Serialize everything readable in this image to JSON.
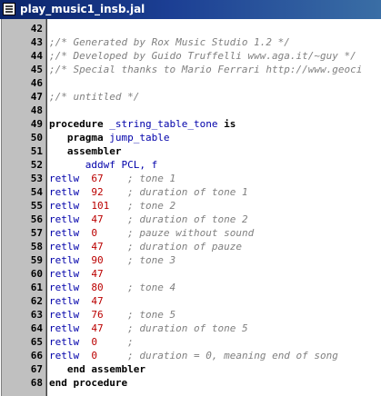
{
  "window": {
    "title": "play_music1_insb.jal"
  },
  "colors": {
    "titlebar": "#0a246a",
    "comment": "#808080",
    "keyword": "#000000",
    "instruction": "#0000aa",
    "number": "#bb0000",
    "gutter": "#c0c0c0"
  },
  "icons": [
    "document-icon"
  ],
  "lines": [
    {
      "n": "42",
      "text": ""
    },
    {
      "n": "43",
      "text": ";/* Generated by Rox Music Studio 1.2 */"
    },
    {
      "n": "44",
      "text": ";/* Developed by Guido Truffelli www.aga.it/~guy */"
    },
    {
      "n": "45",
      "text": ";/* Special thanks to Mario Ferrari http://www.geoci"
    },
    {
      "n": "46",
      "text": ""
    },
    {
      "n": "47",
      "text": ";/* untitled */"
    },
    {
      "n": "48",
      "text": ""
    },
    {
      "n": "49",
      "kw": "procedure",
      "ident": "_string_table_tone",
      "kw2": "is"
    },
    {
      "n": "50",
      "indent": "   ",
      "kw": "pragma",
      "ident": "jump_table"
    },
    {
      "n": "51",
      "indent": "   ",
      "kw": "assembler"
    },
    {
      "n": "52",
      "indent": "      ",
      "ident": "addwf PCL, f"
    },
    {
      "n": "53",
      "op": "retlw",
      "val": "67",
      "cmt": "; tone 1"
    },
    {
      "n": "54",
      "op": "retlw",
      "val": "92",
      "cmt": "; duration of tone 1"
    },
    {
      "n": "55",
      "op": "retlw",
      "val": "101",
      "cmt": "; tone 2"
    },
    {
      "n": "56",
      "op": "retlw",
      "val": "47",
      "cmt": "; duration of tone 2"
    },
    {
      "n": "57",
      "op": "retlw",
      "val": "0",
      "cmt": "; pauze without sound"
    },
    {
      "n": "58",
      "op": "retlw",
      "val": "47",
      "cmt": "; duration of pauze"
    },
    {
      "n": "59",
      "op": "retlw",
      "val": "90",
      "cmt": "; tone 3"
    },
    {
      "n": "60",
      "op": "retlw",
      "val": "47",
      "cmt": ""
    },
    {
      "n": "61",
      "op": "retlw",
      "val": "80",
      "cmt": "; tone 4"
    },
    {
      "n": "62",
      "op": "retlw",
      "val": "47",
      "cmt": ""
    },
    {
      "n": "63",
      "op": "retlw",
      "val": "76",
      "cmt": "; tone 5"
    },
    {
      "n": "64",
      "op": "retlw",
      "val": "47",
      "cmt": "; duration of tone 5"
    },
    {
      "n": "65",
      "op": "retlw",
      "val": "0",
      "cmt": ";"
    },
    {
      "n": "66",
      "op": "retlw",
      "val": "0",
      "cmt": "; duration = 0, meaning end of song"
    },
    {
      "n": "67",
      "indent": "   ",
      "kw": "end assembler"
    },
    {
      "n": "68",
      "kw": "end procedure"
    }
  ]
}
